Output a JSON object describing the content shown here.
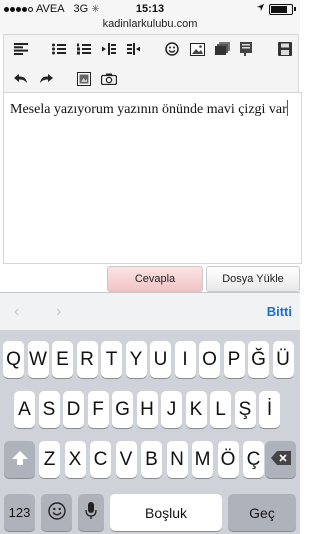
{
  "status_bar": {
    "carrier": "AVEA",
    "network": "3G",
    "time": "15:13",
    "battery_level": 0.8
  },
  "url": "kadinlarkulubu.com",
  "toolbar": {
    "row1_icons": [
      "align-left-icon",
      "bullet-list-icon",
      "numbered-list-icon",
      "outdent-icon",
      "indent-icon",
      "emoji-icon",
      "image-icon",
      "gallery-icon",
      "quote-icon",
      "save-icon"
    ],
    "row2_icons": [
      "undo-icon",
      "redo-icon",
      "media-icon",
      "camera-icon"
    ]
  },
  "editor": {
    "text": "Mesela yazıyorum yazının önünde mavi çizgi var"
  },
  "buttons": {
    "reply": "Cevapla",
    "upload": "Dosya Yükle"
  },
  "accessory": {
    "prev": "‹",
    "next": "›",
    "done": "Bitti"
  },
  "keyboard": {
    "row1": [
      "Q",
      "W",
      "E",
      "R",
      "T",
      "Y",
      "U",
      "I",
      "O",
      "P",
      "Ğ",
      "Ü"
    ],
    "row2": [
      "A",
      "S",
      "D",
      "F",
      "G",
      "H",
      "J",
      "K",
      "L",
      "Ş",
      "İ"
    ],
    "row3": [
      "Z",
      "X",
      "C",
      "V",
      "B",
      "N",
      "M",
      "Ö",
      "Ç"
    ],
    "numbers": "123",
    "space": "Boşluk",
    "return": "Geç"
  }
}
